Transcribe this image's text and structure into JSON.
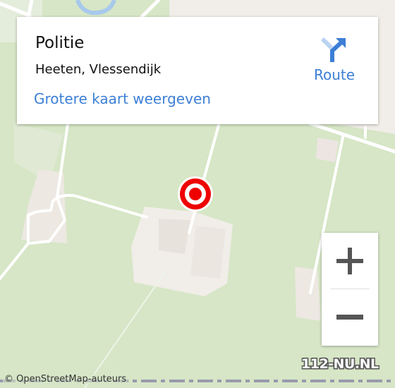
{
  "info_card": {
    "title": "Politie",
    "address": "Heeten, Vlessendijk",
    "bigger_map_link": "Grotere kaart weergeven",
    "route_label": "Route"
  },
  "map": {
    "marker_icon": "target-marker-icon",
    "zoom_in_icon": "plus-icon",
    "zoom_out_icon": "minus-icon",
    "attribution": "© OpenStreetMap-auteurs",
    "watermark": "112-NU.NL"
  },
  "colors": {
    "accent": "#3c7fd6",
    "route_icon_light": "#bcd3f2",
    "marker_red": "#ee0000",
    "land_green": "#d6e6c6",
    "built_area": "#f1ede8",
    "water": "#a7c9ec",
    "boundary_dash": "#9a9aae"
  }
}
